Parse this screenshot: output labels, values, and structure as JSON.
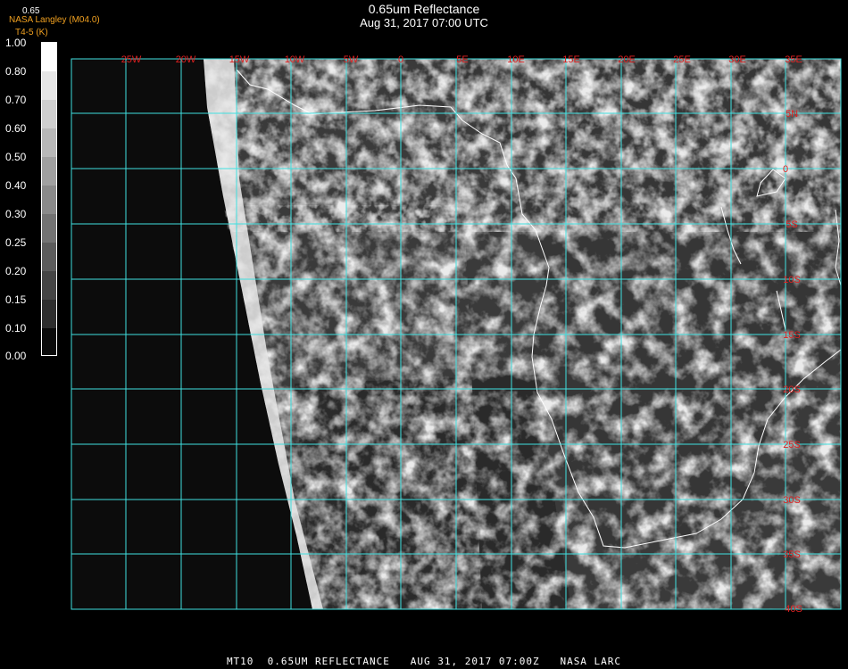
{
  "header": {
    "title": "0.65um Reflectance",
    "subtitle": "Aug 31, 2017 07:00 UTC",
    "producer": "NASA Langley (M04.0)",
    "unit_label": "T4-5 (K)",
    "top_value": "0.65"
  },
  "colorbar": {
    "ticks": [
      "1.00",
      "0.80",
      "0.70",
      "0.60",
      "0.50",
      "0.40",
      "0.30",
      "0.25",
      "0.20",
      "0.15",
      "0.10",
      "0.00"
    ]
  },
  "map": {
    "lon_labels": [
      "25W",
      "20W",
      "15W",
      "10W",
      "5W",
      "0",
      "5E",
      "10E",
      "15E",
      "20E",
      "25E",
      "30E",
      "35E"
    ],
    "lat_labels": [
      "5N",
      "0",
      "5S",
      "10S",
      "15S",
      "20S",
      "25S",
      "30S",
      "35S",
      "40S"
    ],
    "grid_color": "#40e0e0",
    "label_color": "#e02020",
    "coast_color": "#ffffff"
  },
  "footer": {
    "text": "MT10  0.65UM REFLECTANCE   AUG 31, 2017 07:00Z   NASA LARC"
  }
}
